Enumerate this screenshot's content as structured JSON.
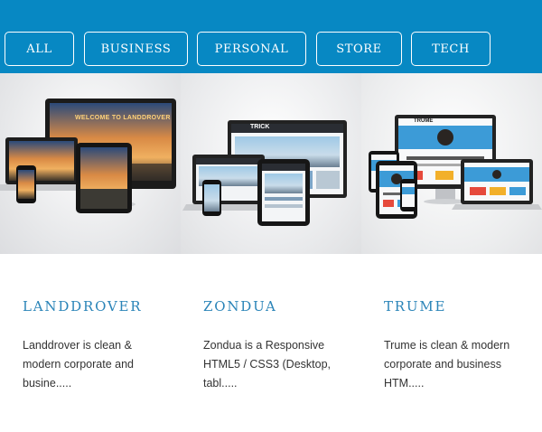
{
  "filters": [
    {
      "label": "ALL"
    },
    {
      "label": "BUSINESS"
    },
    {
      "label": "PERSONAL"
    },
    {
      "label": "STORE"
    },
    {
      "label": "TECH"
    }
  ],
  "themes": [
    {
      "name": "LANDDROVER",
      "description": "Landdrover is clean & modern corporate and busine.....",
      "screen_text": "WELCOME TO LANDDROVER"
    },
    {
      "name": "ZONDUA",
      "description": "Zondua is a Responsive HTML5 / CSS3 (Desktop, tabl.....",
      "screen_text": "TRICK"
    },
    {
      "name": "TRUME",
      "description": "Trume is clean & modern corporate and business HTM.....",
      "screen_text": "TRUME"
    }
  ],
  "colors": {
    "header_blue": "#0788c3",
    "title_blue": "#2a84b8",
    "body_text": "#333333"
  }
}
